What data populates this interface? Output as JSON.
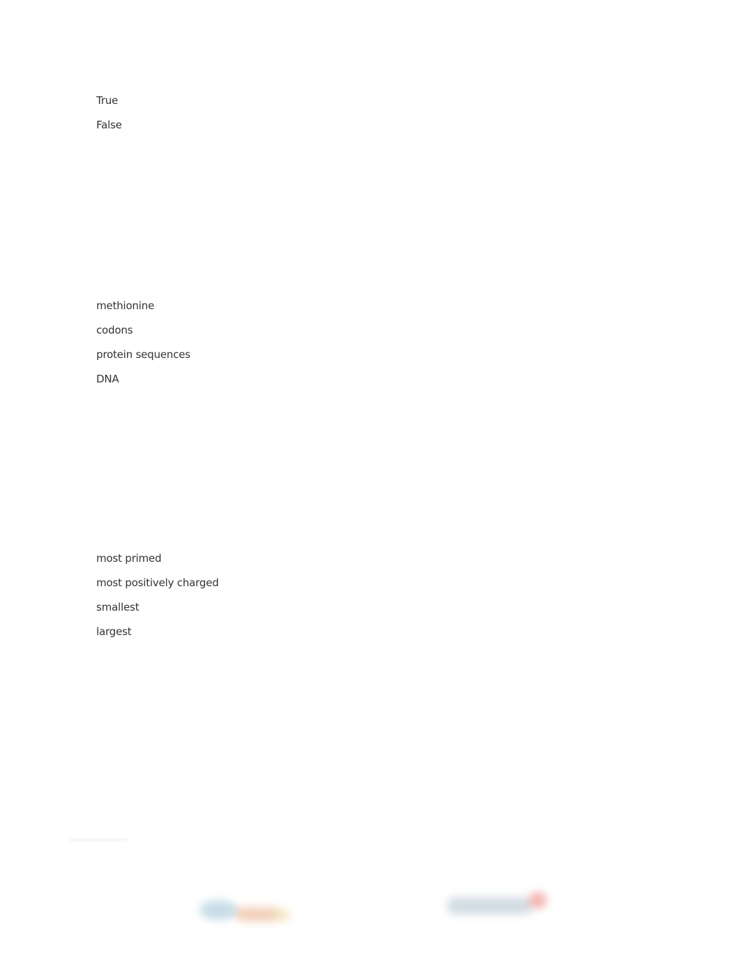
{
  "questions": [
    {
      "options": [
        "True",
        "False"
      ]
    },
    {
      "options": [
        "methionine",
        "codons",
        "protein sequences",
        "DNA"
      ]
    },
    {
      "options": [
        "most primed",
        "most positively charged",
        "smallest",
        "largest"
      ]
    }
  ],
  "footer": {
    "logos": [
      "blurred-logo-left",
      "blurred-logo-right"
    ]
  }
}
